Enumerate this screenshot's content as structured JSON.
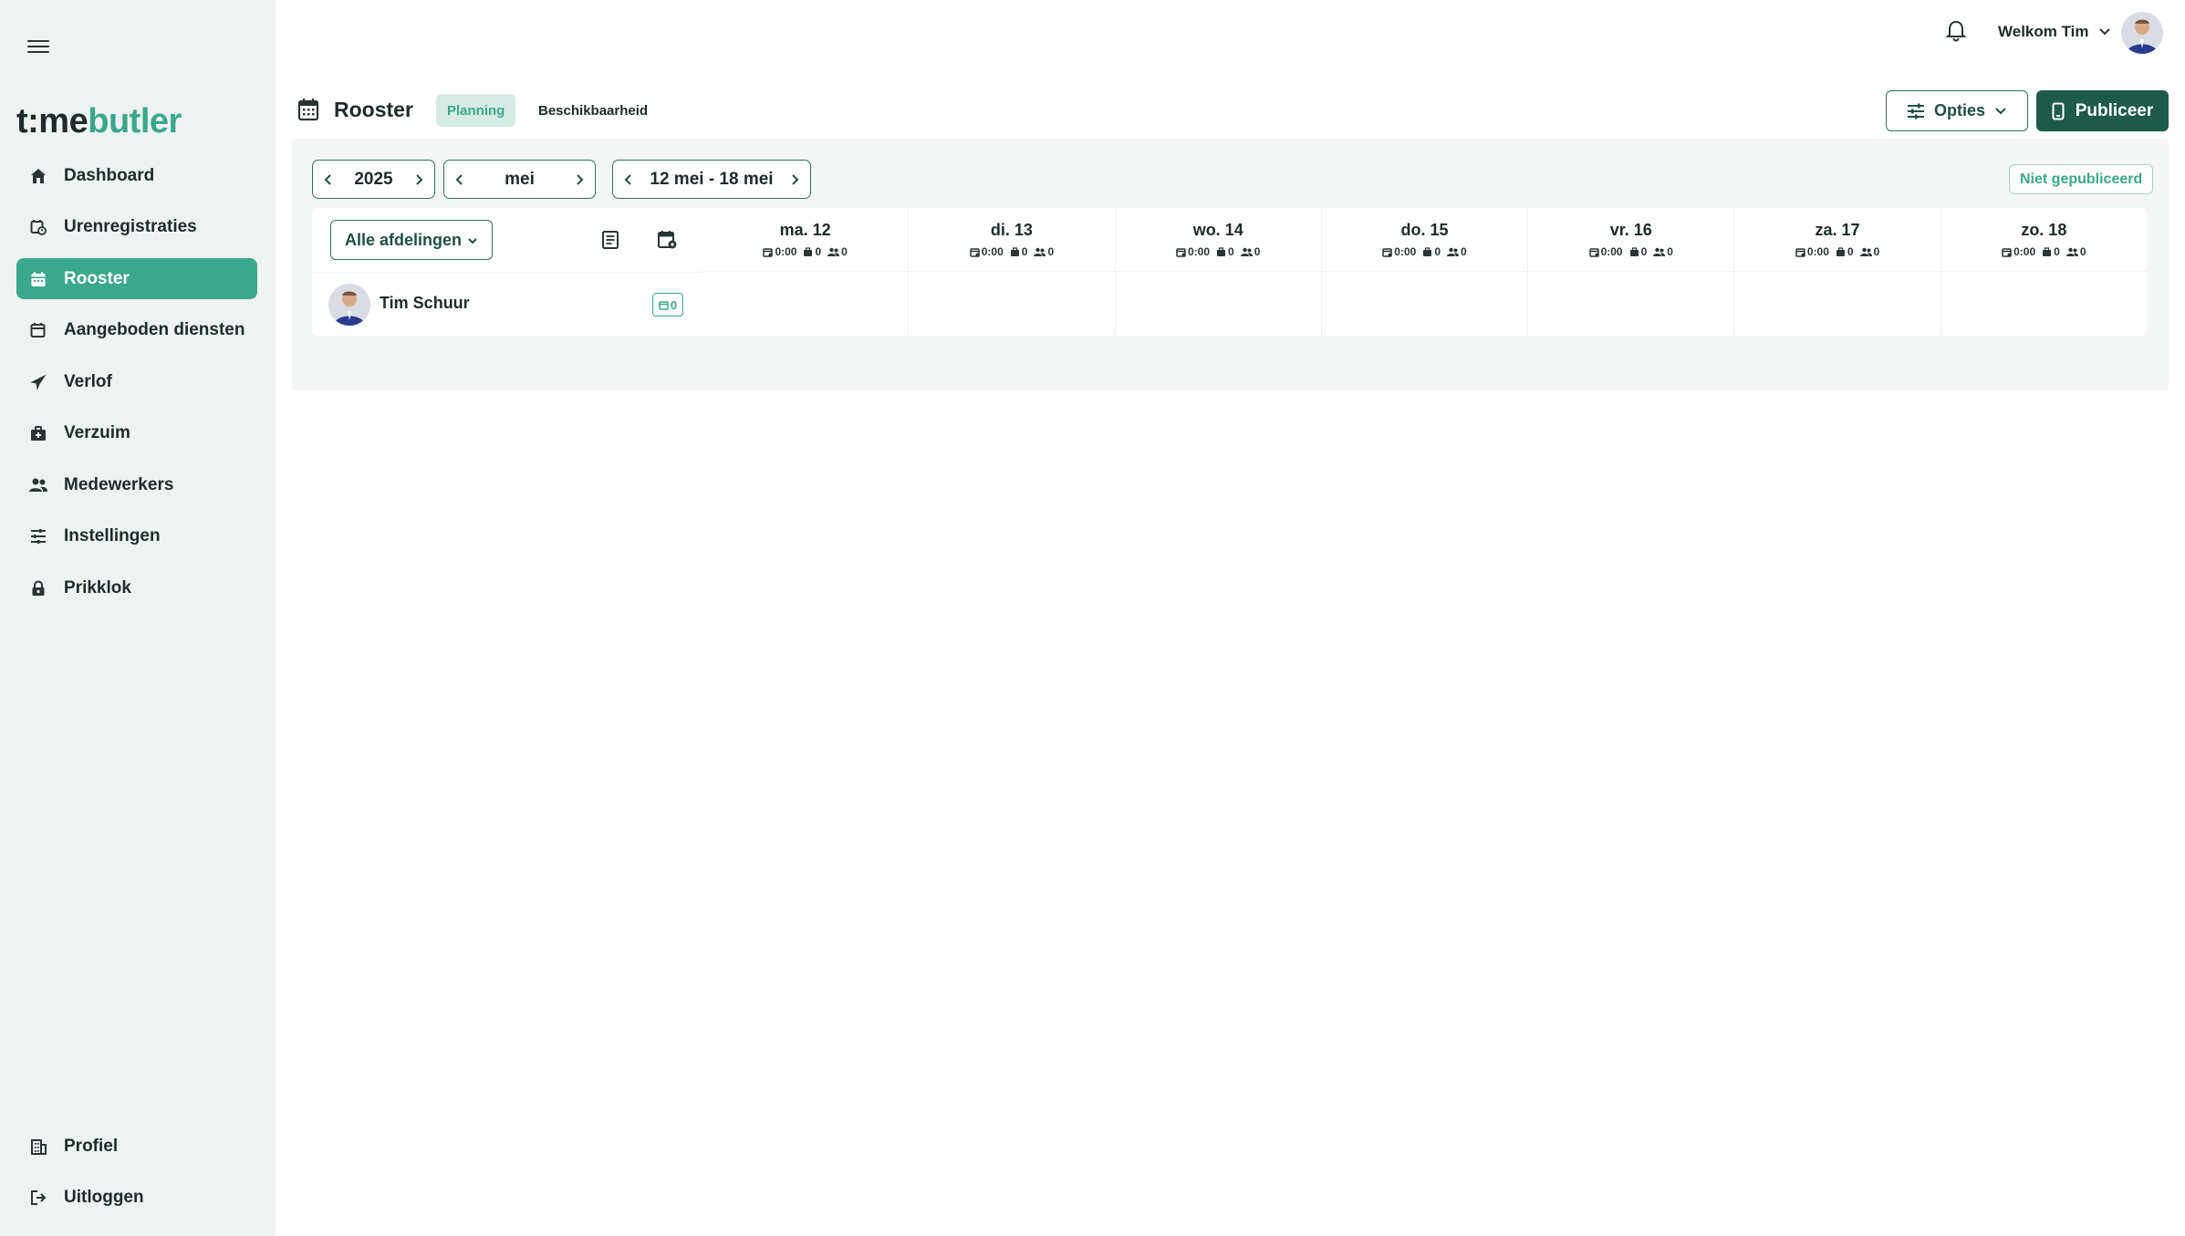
{
  "app": {
    "logo_part1": "t:me",
    "logo_part2": "butler"
  },
  "sidebar": {
    "items": [
      {
        "label": "Dashboard",
        "icon": "home-icon"
      },
      {
        "label": "Urenregistraties",
        "icon": "calendar-clock-icon"
      },
      {
        "label": "Rooster",
        "icon": "calendar-icon",
        "active": true
      },
      {
        "label": "Aangeboden diensten",
        "icon": "calendar-share-icon"
      },
      {
        "label": "Verlof",
        "icon": "airplane-icon"
      },
      {
        "label": "Verzuim",
        "icon": "medical-bag-icon"
      },
      {
        "label": "Medewerkers",
        "icon": "people-icon"
      },
      {
        "label": "Instellingen",
        "icon": "sliders-icon"
      },
      {
        "label": "Prikklok",
        "icon": "clock-lock-icon"
      }
    ],
    "bottom_items": [
      {
        "label": "Profiel",
        "icon": "building-icon"
      },
      {
        "label": "Uitloggen",
        "icon": "logout-icon"
      }
    ]
  },
  "topbar": {
    "welcome": "Welkom Tim"
  },
  "page": {
    "title": "Rooster",
    "tabs": [
      {
        "label": "Planning",
        "active": true
      },
      {
        "label": "Beschikbaarheid",
        "active": false
      }
    ],
    "options_label": "Opties",
    "publish_label": "Publiceer"
  },
  "navigation": {
    "year": "2025",
    "month": "mei",
    "week": "12 mei - 18 mei"
  },
  "status": "Niet gepubliceerd",
  "department_filter": "Alle afdelingen",
  "days": [
    {
      "name": "ma. 12",
      "hours": "0:00",
      "shifts": "0",
      "people": "0"
    },
    {
      "name": "di. 13",
      "hours": "0:00",
      "shifts": "0",
      "people": "0"
    },
    {
      "name": "wo. 14",
      "hours": "0:00",
      "shifts": "0",
      "people": "0"
    },
    {
      "name": "do. 15",
      "hours": "0:00",
      "shifts": "0",
      "people": "0"
    },
    {
      "name": "vr. 16",
      "hours": "0:00",
      "shifts": "0",
      "people": "0"
    },
    {
      "name": "za. 17",
      "hours": "0:00",
      "shifts": "0",
      "people": "0"
    },
    {
      "name": "zo. 18",
      "hours": "0:00",
      "shifts": "0",
      "people": "0"
    }
  ],
  "employees": [
    {
      "name": "Tim Schuur",
      "badge_count": "0"
    }
  ],
  "colors": {
    "accent": "#3aa88a",
    "primary_dark": "#1e5a4a",
    "sidebar_bg": "#eef2f1"
  }
}
